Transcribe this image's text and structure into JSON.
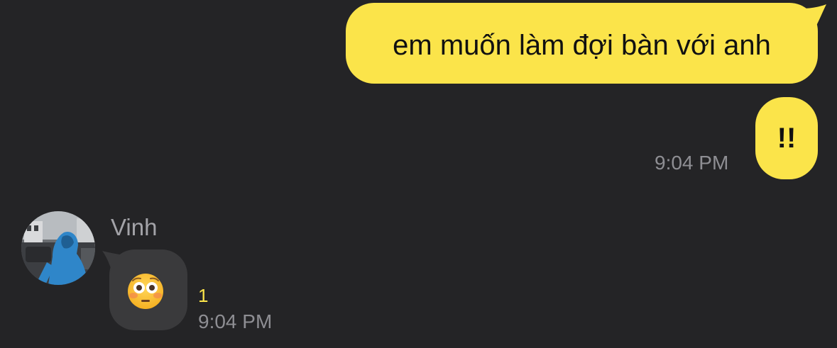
{
  "colors": {
    "background": "#242426",
    "outgoing_bubble": "#FBE44A",
    "incoming_bubble": "#3a3a3c",
    "timestamp": "#8e8e93",
    "unread_count": "#FBE44A"
  },
  "messages_out": [
    {
      "text": "em muốn làm đợi bàn với anh"
    },
    {
      "text": "!!",
      "time": "9:04 PM"
    }
  ],
  "message_in": {
    "sender": "Vinh",
    "avatar_icon": "profile-photo",
    "emoji_icon": "flushed-face-emoji",
    "unread": "1",
    "time": "9:04 PM"
  }
}
